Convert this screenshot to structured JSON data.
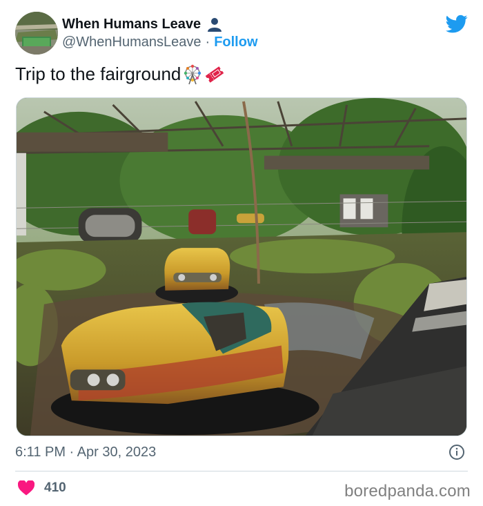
{
  "author": {
    "display_name": "When Humans Leave",
    "handle": "@WhenHumansLeave",
    "separator": "·",
    "follow_label": "Follow",
    "avatar_icon": "avatar-abandoned-pool",
    "badge_icon": "person-silhouette-icon"
  },
  "tweet": {
    "text": "Trip to the fairground",
    "emojis": [
      "ferris-wheel-emoji",
      "ticket-emoji"
    ],
    "image_icon": "abandoned-bumper-cars-photo",
    "timestamp": "6:11 PM · Apr 30, 2023"
  },
  "engagement": {
    "like_count": "410",
    "like_icon": "heart-icon",
    "info_icon": "info-circle-icon"
  },
  "brand": {
    "twitter_icon": "twitter-bird-icon",
    "watermark": "boredpanda.com"
  },
  "colors": {
    "accent": "#1d9bf0",
    "like": "#f91880",
    "secondary_text": "#536471",
    "primary_text": "#0f1419",
    "divider": "#cfd9de"
  }
}
